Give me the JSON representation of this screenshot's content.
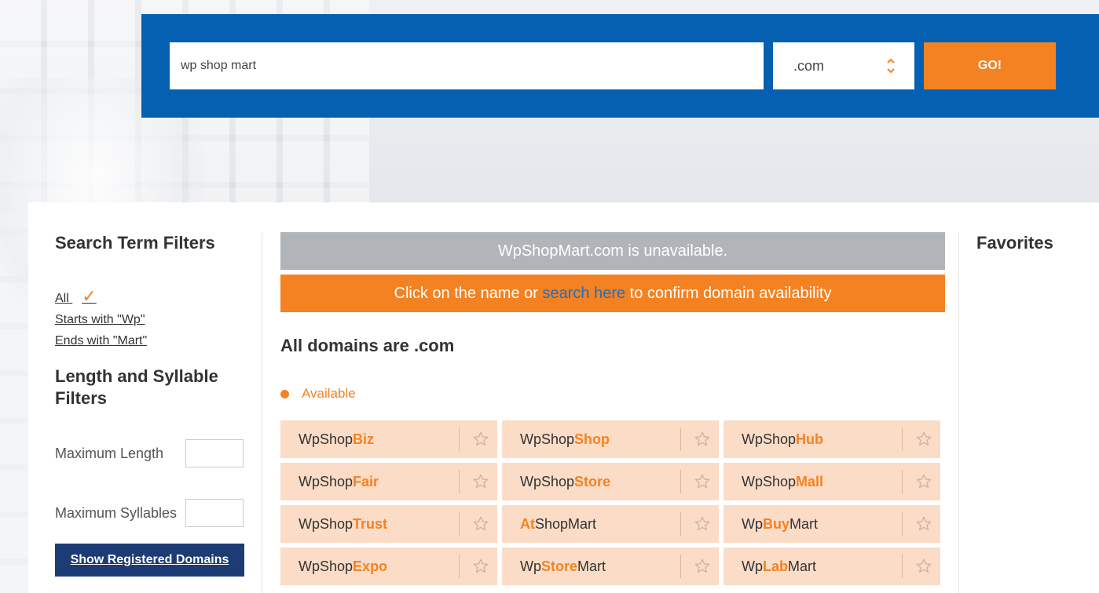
{
  "search": {
    "query": "wp shop mart",
    "tld": ".com",
    "go_label": "GO!"
  },
  "filters": {
    "search_term_title": "Search Term Filters",
    "all_label": "All",
    "check": "✓",
    "starts_with": "Starts with \"Wp\"",
    "ends_with": "Ends with \"Mart\"",
    "length_title": "Length and Syllable Filters",
    "max_length_label": "Maximum Length",
    "max_syllables_label": "Maximum Syllables",
    "show_registered": "Show Registered Domains"
  },
  "results": {
    "unavailable_msg": "WpShopMart.com is unavailable.",
    "confirm_pre": "Click on the name or ",
    "confirm_link": "search here",
    "confirm_post": " to confirm domain availability",
    "domains_title": "All domains are .com",
    "legend_available": "Available",
    "domains": [
      {
        "pre": "WpShop",
        "hl": "Biz",
        "post": ""
      },
      {
        "pre": "WpShop",
        "hl": "Shop",
        "post": ""
      },
      {
        "pre": "WpShop",
        "hl": "Hub",
        "post": ""
      },
      {
        "pre": "WpShop",
        "hl": "Fair",
        "post": ""
      },
      {
        "pre": "WpShop",
        "hl": "Store",
        "post": ""
      },
      {
        "pre": "WpShop",
        "hl": "Mall",
        "post": ""
      },
      {
        "pre": "WpShop",
        "hl": "Trust",
        "post": ""
      },
      {
        "pre": "",
        "hl": "At",
        "post": "ShopMart"
      },
      {
        "pre": "Wp",
        "hl": "Buy",
        "post": "Mart"
      },
      {
        "pre": "WpShop",
        "hl": "Expo",
        "post": ""
      },
      {
        "pre": "Wp",
        "hl": "Store",
        "post": "Mart"
      },
      {
        "pre": "Wp",
        "hl": "Lab",
        "post": "Mart"
      }
    ]
  },
  "favorites": {
    "title": "Favorites"
  },
  "colors": {
    "brand_blue": "#0560b1",
    "accent_orange": "#f48222",
    "cell_bg": "#fbdcc6",
    "dark_navy": "#1d3b74"
  },
  "icons": {
    "star": "star-outline-icon",
    "select_arrows": "chevron-up-down-icon",
    "available_dot": "dot-icon"
  }
}
